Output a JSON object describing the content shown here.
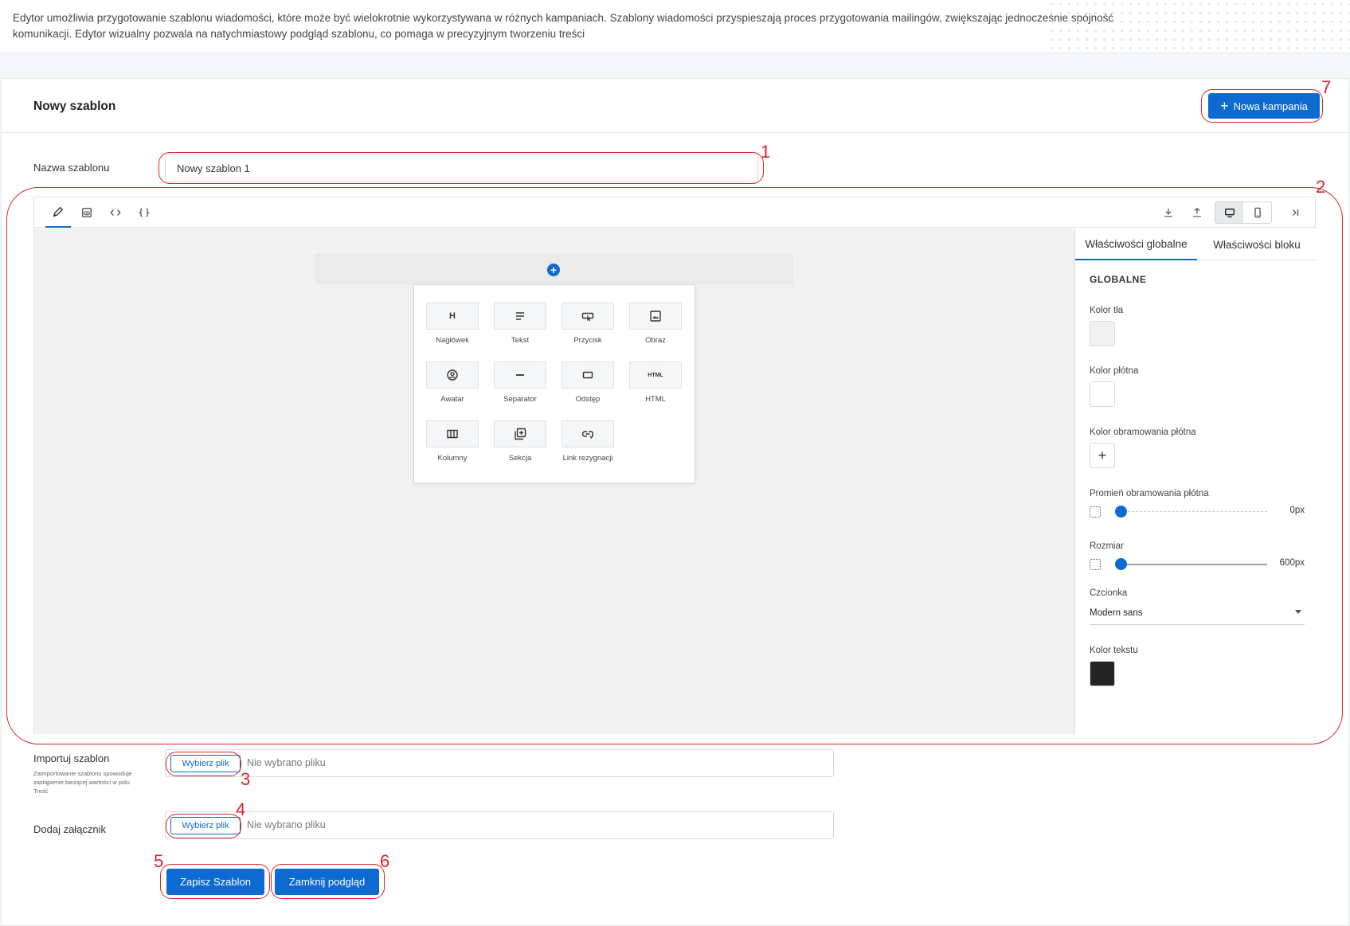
{
  "info": {
    "text": "Edytor umożliwia przygotowanie szablonu wiadomości, które może być wielokrotnie wykorzystywana w różnych kampaniach. Szablony wiadomości przyspieszają proces przygotowania mailingów, zwiększając jednocześnie spójność komunikacji. Edytor wizualny pozwala na natychmiastowy podgląd szablonu, co pomaga w precyzyjnym tworzeniu treści"
  },
  "header": {
    "title": "Nowy szablon",
    "new_campaign_label": "Nowa kampania"
  },
  "form": {
    "name_label": "Nazwa szablonu",
    "name_value": "Nowy szablon 1",
    "import_label": "Importuj szablon",
    "import_hint": "Zaimportowanie szablonu spowoduje zastąpienie bieżącej wartości w polu Treść",
    "attach_label": "Dodaj załącznik",
    "file_button": "Wybierz plik",
    "no_file": "Nie wybrano pliku",
    "save_label": "Zapisz Szablon",
    "close_label": "Zamknij podgląd"
  },
  "editor": {
    "blocks": [
      {
        "label": "Nagłówek",
        "icon": "heading-icon"
      },
      {
        "label": "Tekst",
        "icon": "text-icon"
      },
      {
        "label": "Przycisk",
        "icon": "button-icon"
      },
      {
        "label": "Obraz",
        "icon": "image-icon"
      },
      {
        "label": "Awatar",
        "icon": "avatar-icon"
      },
      {
        "label": "Separator",
        "icon": "separator-icon"
      },
      {
        "label": "Odstęp",
        "icon": "spacer-icon"
      },
      {
        "label": "HTML",
        "icon": "html-icon"
      },
      {
        "label": "Kolumny",
        "icon": "columns-icon"
      },
      {
        "label": "Sekcja",
        "icon": "section-icon"
      },
      {
        "label": "Link rezygnacji",
        "icon": "unsubscribe-link-icon"
      }
    ],
    "block_glyphs": {
      "heading": "H",
      "html": "HTML"
    },
    "panel": {
      "tab_global": "Właściwości globalne",
      "tab_block": "Właściwości bloku",
      "section_title": "GLOBALNE",
      "bg_color_label": "Kolor tła",
      "bg_color": "#f2f2f2",
      "canvas_color_label": "Kolor płótna",
      "canvas_color": "#ffffff",
      "border_color_label": "Kolor obramowania płótna",
      "radius_label": "Promień obramowania płótna",
      "radius_value": "0px",
      "size_label": "Rozmiar",
      "size_value": "600px",
      "font_label": "Czcionka",
      "font_value": "Modern sans",
      "text_color_label": "Kolor tekstu",
      "text_color": "#242424"
    }
  },
  "annotations": {
    "n1": "1",
    "n2": "2",
    "n3": "3",
    "n4": "4",
    "n5": "5",
    "n6": "6",
    "n7": "7"
  },
  "colors": {
    "accent": "#0d6ad1",
    "annotation": "#e0222b"
  }
}
